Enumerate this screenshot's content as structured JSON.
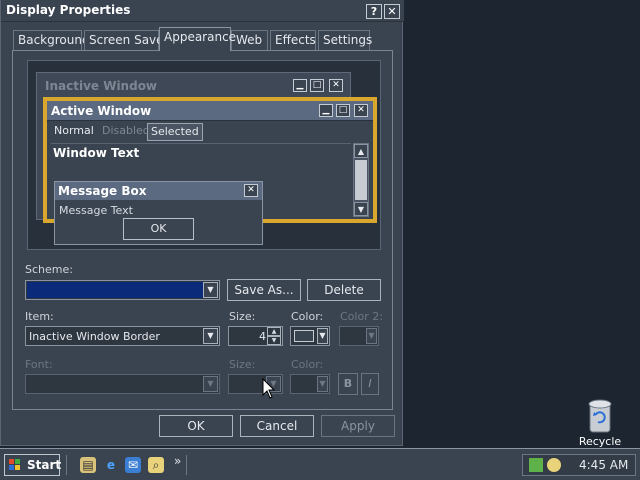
{
  "dialog": {
    "title": "Display Properties",
    "help_btn": "?",
    "close_btn": "✕",
    "tabs": [
      {
        "label": "Background"
      },
      {
        "label": "Screen Saver"
      },
      {
        "label": "Appearance"
      },
      {
        "label": "Web"
      },
      {
        "label": "Effects"
      },
      {
        "label": "Settings"
      }
    ]
  },
  "preview": {
    "inactive_title": "Inactive Window",
    "active_title": "Active Window",
    "menu": {
      "normal": "Normal",
      "disabled": "Disabled",
      "selected": "Selected"
    },
    "window_text": "Window Text",
    "msgbox_title": "Message Box",
    "msgbox_text": "Message Text",
    "msgbox_ok": "OK",
    "min_glyph": "▁",
    "max_glyph": "□",
    "close_glyph": "✕"
  },
  "form": {
    "scheme_label": "Scheme:",
    "scheme_value": "",
    "save_as": "Save As...",
    "delete": "Delete",
    "item_label": "Item:",
    "item_value": "Inactive Window Border",
    "size_label": "Size:",
    "size_value": "4",
    "color_label": "Color:",
    "color2_label": "Color 2:",
    "font_label": "Font:",
    "font_size_label": "Size:",
    "font_color_label": "Color:",
    "bold": "B",
    "italic": "I"
  },
  "buttons": {
    "ok": "OK",
    "cancel": "Cancel",
    "apply": "Apply"
  },
  "taskbar": {
    "start": "Start",
    "clock": "4:45 AM",
    "chevron": "»"
  },
  "desktop": {
    "recycle_bin": "Recycle Bin"
  },
  "colors": {
    "scheme_selected": "#0b2a7a",
    "active_border": "#d9a62e",
    "accent": "#5b6a80"
  }
}
